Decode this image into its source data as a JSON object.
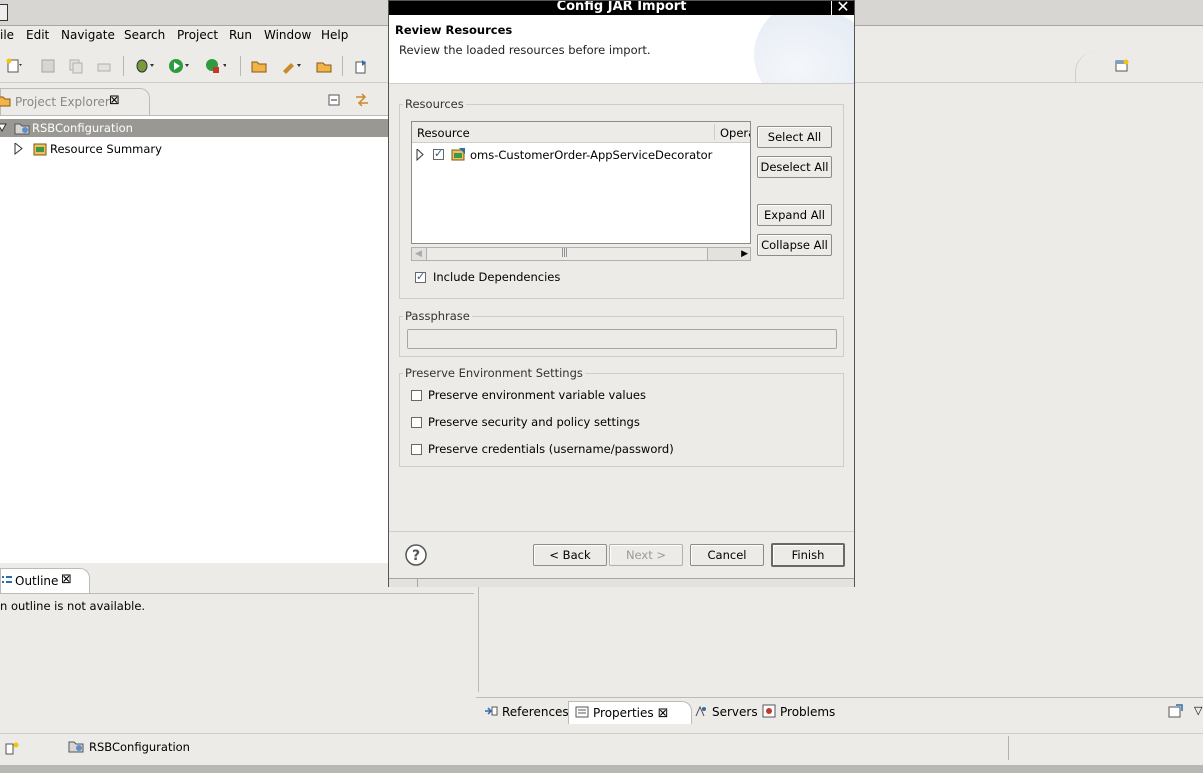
{
  "menubar": {
    "items": [
      {
        "label": "ile"
      },
      {
        "label": "Edit"
      },
      {
        "label": "Navigate"
      },
      {
        "label": "Search"
      },
      {
        "label": "Project"
      },
      {
        "label": "Run"
      },
      {
        "label": "Window"
      },
      {
        "label": "Help"
      }
    ]
  },
  "explorer": {
    "tab_label": "Project Explorer",
    "tree": [
      {
        "label": "RSBConfiguration"
      },
      {
        "label": "Resource Summary"
      }
    ]
  },
  "outline": {
    "tab_label": "Outline",
    "message": "n outline is not available."
  },
  "bottom_tabs": [
    {
      "label": "References"
    },
    {
      "label": "Properties"
    },
    {
      "label": "Servers"
    },
    {
      "label": "Problems"
    }
  ],
  "statusbar": {
    "project": "RSBConfiguration"
  },
  "dialog": {
    "title": "Config JAR Import",
    "header_title": "Review Resources",
    "header_desc": "Review the loaded resources before import.",
    "resources_group": "Resources",
    "table_columns": [
      "Resource",
      "Opera"
    ],
    "table_rows": [
      {
        "label": "oms-CustomerOrder-AppServiceDecorator",
        "checked": true
      }
    ],
    "buttons_side": {
      "select_all": "Select All",
      "deselect_all": "Deselect All",
      "expand_all": "Expand All",
      "collapse_all": "Collapse All"
    },
    "include_dependencies": {
      "label": "Include Dependencies",
      "checked": true
    },
    "passphrase_group": "Passphrase",
    "passphrase_value": "",
    "preserve_group": "Preserve Environment Settings",
    "preserve_options": [
      {
        "label": "Preserve environment variable values",
        "checked": false
      },
      {
        "label": "Preserve security and policy settings",
        "checked": false
      },
      {
        "label": "Preserve credentials (username/password)",
        "checked": false
      }
    ],
    "footer": {
      "back": "< Back",
      "next": "Next >",
      "cancel": "Cancel",
      "finish": "Finish"
    }
  }
}
